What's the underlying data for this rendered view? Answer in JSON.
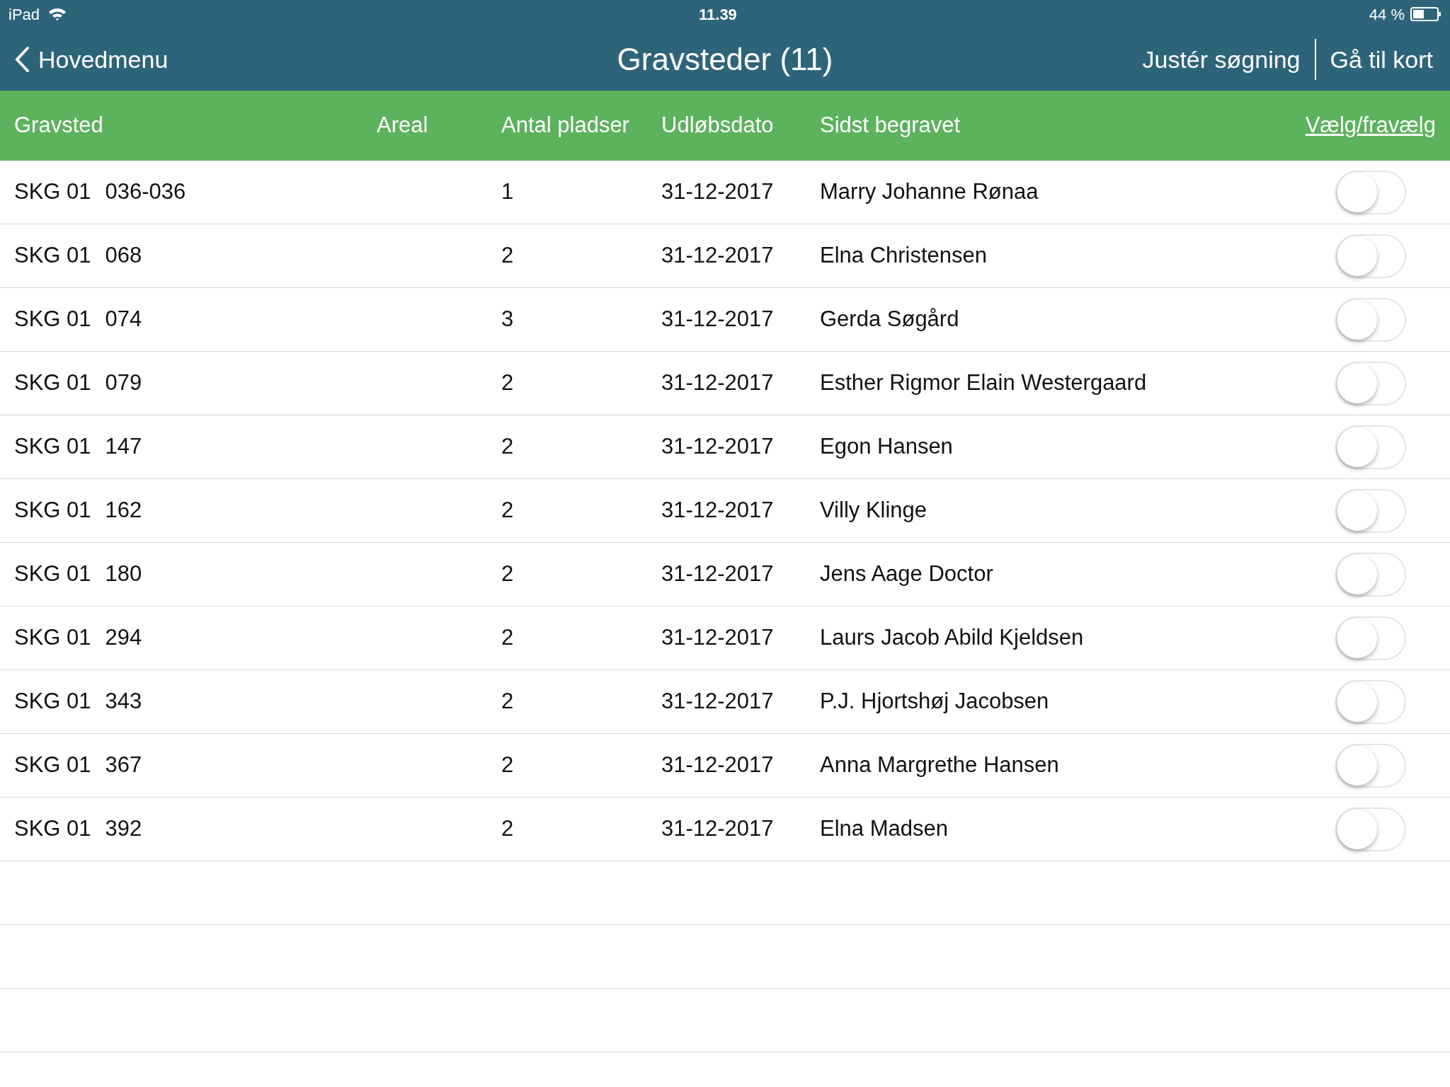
{
  "status_bar": {
    "device": "iPad",
    "time": "11.39",
    "battery": "44 %"
  },
  "nav": {
    "back": "Hovedmenu",
    "title": "Gravsteder (11)",
    "actions": [
      "Justér søgning",
      "Gå til kort"
    ]
  },
  "table": {
    "columns": [
      "Gravsted",
      "Areal",
      "Antal pladser",
      "Udløbsdato",
      "Sidst begravet"
    ],
    "select_link": "Vælg/fravælg",
    "rows": [
      {
        "section": "SKG 01",
        "number": "036-036",
        "places": "1",
        "expiry": "31-12-2017",
        "buried": "Marry Johanne Rønaa",
        "on": false
      },
      {
        "section": "SKG 01",
        "number": "068",
        "places": "2",
        "expiry": "31-12-2017",
        "buried": "Elna Christensen",
        "on": false
      },
      {
        "section": "SKG 01",
        "number": "074",
        "places": "3",
        "expiry": "31-12-2017",
        "buried": "Gerda Søgård",
        "on": false
      },
      {
        "section": "SKG 01",
        "number": "079",
        "places": "2",
        "expiry": "31-12-2017",
        "buried": "Esther Rigmor Elain Westergaard",
        "on": false
      },
      {
        "section": "SKG 01",
        "number": "147",
        "places": "2",
        "expiry": "31-12-2017",
        "buried": "Egon Hansen",
        "on": false
      },
      {
        "section": "SKG 01",
        "number": "162",
        "places": "2",
        "expiry": "31-12-2017",
        "buried": "Villy Klinge",
        "on": false
      },
      {
        "section": "SKG 01",
        "number": "180",
        "places": "2",
        "expiry": "31-12-2017",
        "buried": "Jens Aage Doctor",
        "on": false
      },
      {
        "section": "SKG 01",
        "number": "294",
        "places": "2",
        "expiry": "31-12-2017",
        "buried": "Laurs Jacob Abild Kjeldsen",
        "on": false
      },
      {
        "section": "SKG 01",
        "number": "343",
        "places": "2",
        "expiry": "31-12-2017",
        "buried": "P.J. Hjortshøj Jacobsen",
        "on": false
      },
      {
        "section": "SKG 01",
        "number": "367",
        "places": "2",
        "expiry": "31-12-2017",
        "buried": "Anna Margrethe Hansen",
        "on": false
      },
      {
        "section": "SKG 01",
        "number": "392",
        "places": "2",
        "expiry": "31-12-2017",
        "buried": "Elna Madsen",
        "on": false
      }
    ]
  }
}
